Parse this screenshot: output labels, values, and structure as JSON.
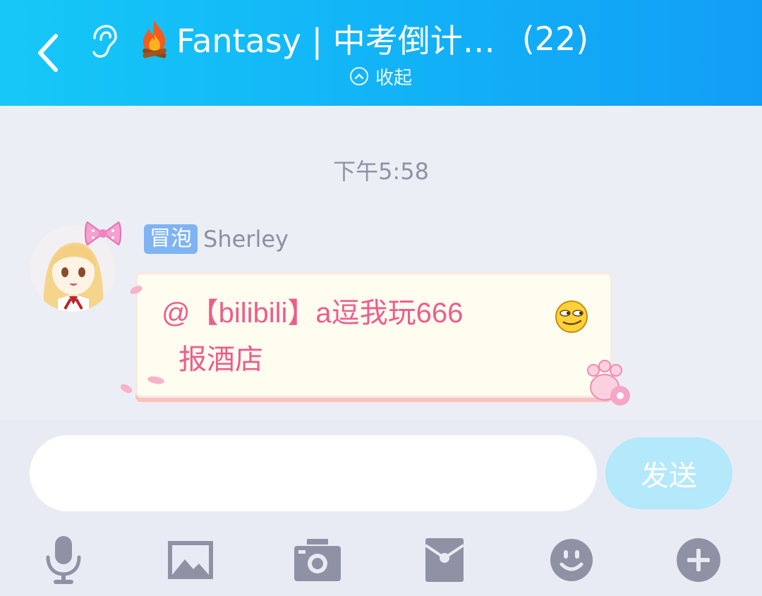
{
  "header": {
    "title": "Fantasy | 中考倒计…",
    "member_count": "(22)",
    "collapse_label": "收起",
    "background": "#12b6f7"
  },
  "icons": {
    "back": "back-arrow-icon",
    "ear": "ear-icon",
    "fire": "fire-icon",
    "collapse": "chevron-up-circle-icon",
    "voice": "microphone-icon",
    "image": "image-icon",
    "camera": "camera-icon",
    "red_packet": "red-packet-icon",
    "emoji": "emoji-icon",
    "more": "plus-icon"
  },
  "chat": {
    "timestamp": "下午5:58",
    "messages": [
      {
        "badge": "冒泡",
        "sender": "Sherley",
        "line1": "@【bilibili】a逗我玩666",
        "line2": "报酒店"
      }
    ]
  },
  "input": {
    "value": "",
    "send_label": "发送"
  },
  "colors": {
    "message_text": "#ec5d8d",
    "badge": "#7fb3f3",
    "send_button": "#b4e8fb",
    "toolbar_icon": "#8e92a4"
  }
}
